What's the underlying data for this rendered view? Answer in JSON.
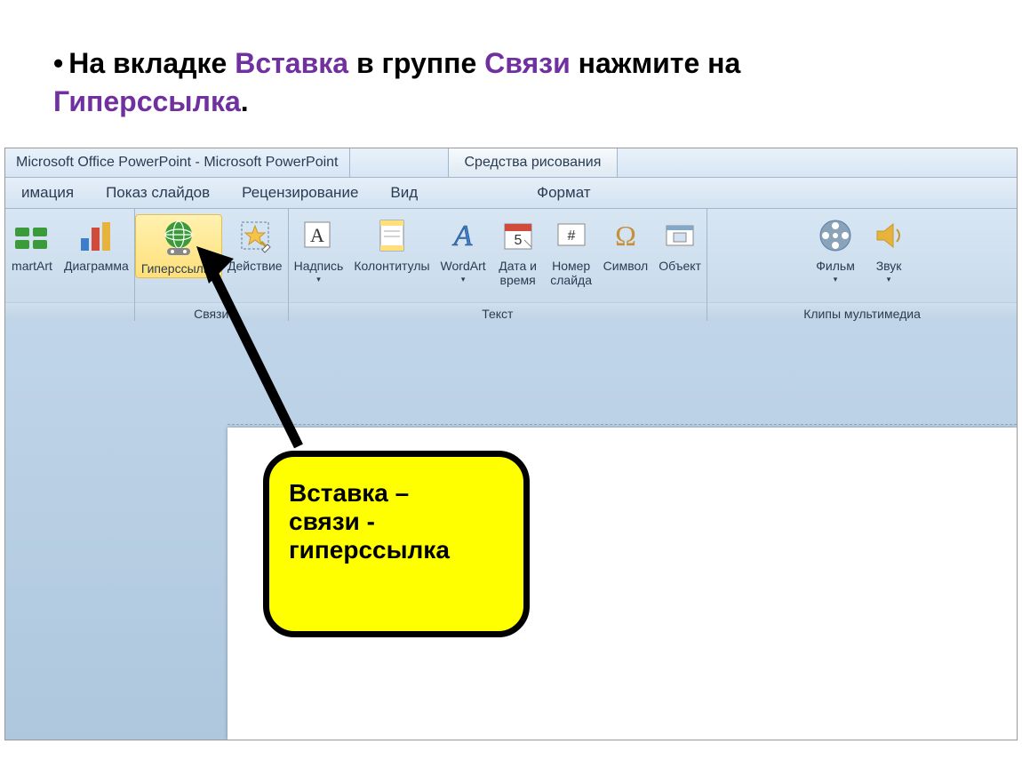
{
  "instruction": {
    "prefix": "На вкладке",
    "tab": "Вставка",
    "mid1": "в группе",
    "group": "Связи",
    "mid2": "нажмите на",
    "button": "Гиперссылка",
    "suffix": "."
  },
  "titlebar": {
    "window": "Microsoft Office PowerPoint - Microsoft PowerPoint",
    "toolTab": "Средства рисования"
  },
  "tabs": {
    "t1": "имация",
    "t2": "Показ слайдов",
    "t3": "Рецензирование",
    "t4": "Вид",
    "t5": "Формат"
  },
  "ribbon": {
    "group1": {
      "b1": "martArt",
      "b2": "Диаграмма"
    },
    "group2": {
      "name": "Связи",
      "b1": "Гиперссылка",
      "b2": "Действие"
    },
    "group3": {
      "name": "Текст",
      "b1": "Надпись",
      "b2": "Колонтитулы",
      "b3": "WordArt",
      "b4": "Дата и\nвремя",
      "b5": "Номер\nслайда",
      "b6": "Символ",
      "b7": "Объект"
    },
    "group4": {
      "name": "Клипы мультимедиа",
      "b1": "Фильм",
      "b2": "Звук"
    }
  },
  "callout": {
    "line1": "Вставка –",
    "line2": "связи -",
    "line3": "гиперссылка"
  },
  "glyph": {
    "dropdown": "▾"
  }
}
